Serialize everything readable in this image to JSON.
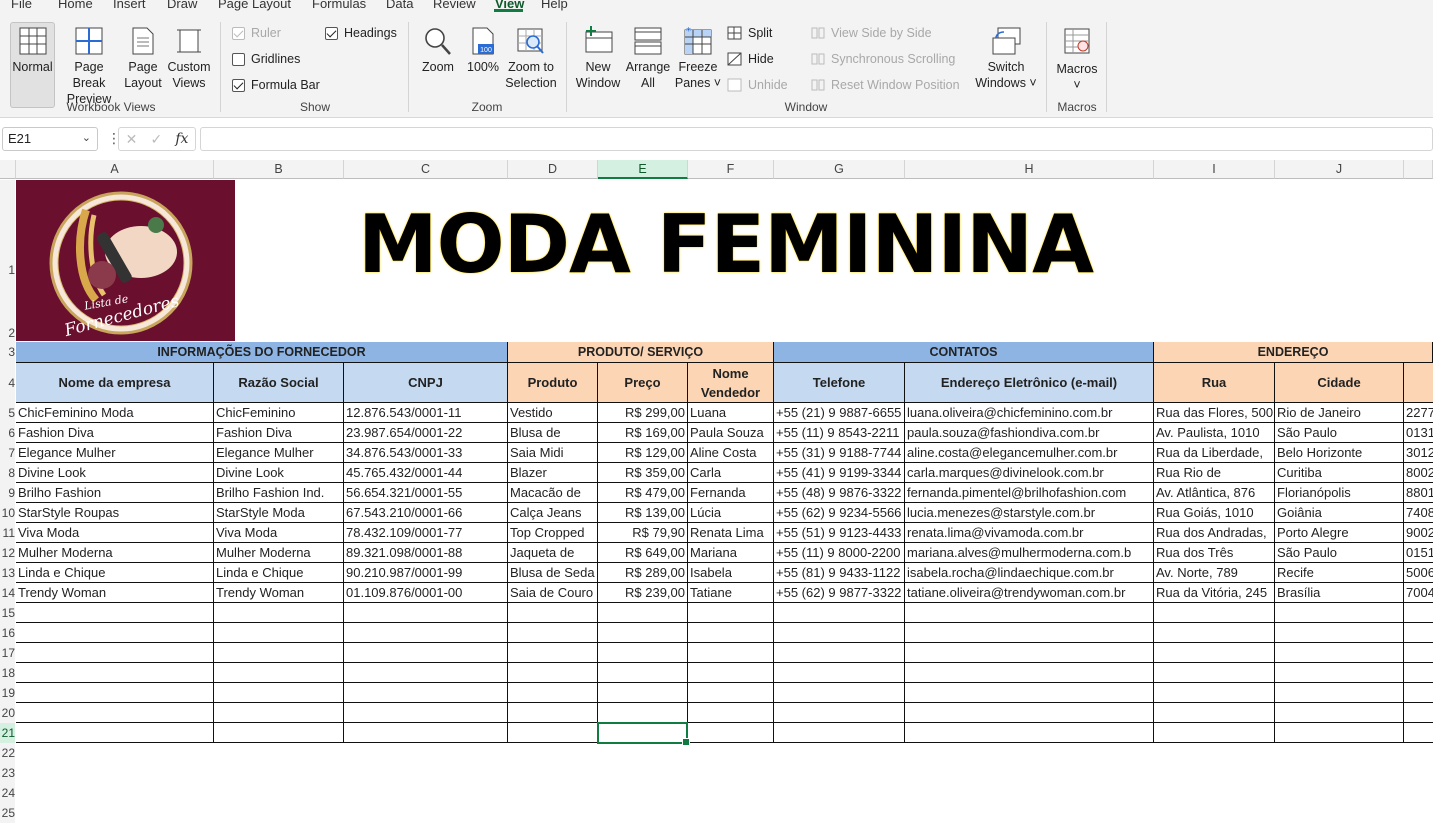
{
  "menu": [
    "File",
    "Home",
    "Insert",
    "Draw",
    "Page Layout",
    "Formulas",
    "Data",
    "Review",
    "View",
    "Help"
  ],
  "menu_active": "View",
  "ribbon": {
    "workbook_views": {
      "label": "Workbook Views",
      "normal": "Normal",
      "page_break": "Page Break",
      "page_break2": "Preview",
      "page_layout": "Page",
      "page_layout2": "Layout",
      "custom": "Custom",
      "custom2": "Views"
    },
    "show": {
      "label": "Show",
      "ruler": "Ruler",
      "gridlines": "Gridlines",
      "formula_bar": "Formula Bar",
      "headings": "Headings",
      "ruler_checked": true,
      "gridlines_checked": false,
      "formula_bar_checked": true,
      "headings_checked": true
    },
    "zoom": {
      "label": "Zoom",
      "zoom": "Zoom",
      "hundred": "100%",
      "zoom_sel": "Zoom to",
      "zoom_sel2": "Selection",
      "badge": "100"
    },
    "window": {
      "label": "Window",
      "new_window": "New",
      "new_window2": "Window",
      "arrange": "Arrange",
      "arrange2": "All",
      "freeze": "Freeze",
      "freeze2": "Panes ˅",
      "split": "Split",
      "hide": "Hide",
      "unhide": "Unhide",
      "side_by_side": "View Side by Side",
      "sync_scroll": "Synchronous Scrolling",
      "reset_pos": "Reset Window Position",
      "switch": "Switch",
      "switch2": "Windows ˅"
    },
    "macros": {
      "label": "Macros",
      "macros": "Macros",
      "macros2": "˅"
    }
  },
  "formula_bar": {
    "name_box": "E21",
    "fx": "fx",
    "content": ""
  },
  "columns": [
    "A",
    "B",
    "C",
    "D",
    "E",
    "F",
    "G",
    "H",
    "I",
    "J",
    ""
  ],
  "selected_column": "E",
  "rows": [
    "1",
    "2",
    "3",
    "4",
    "5",
    "6",
    "7",
    "8",
    "9",
    "10",
    "11",
    "12",
    "13",
    "14",
    "15",
    "16",
    "17",
    "18",
    "19",
    "20",
    "21",
    "22",
    "23",
    "24",
    "25"
  ],
  "selected_row": "21",
  "title": "MODA FEMININA",
  "logo": {
    "line1": "Lista de",
    "line2": "Fornecedores"
  },
  "group_headers": {
    "fornecedor": "INFORMAÇÕES DO FORNECEDOR",
    "produto": "PRODUTO/ SERVIÇO",
    "contatos": "CONTATOS",
    "endereco": "ENDEREÇO"
  },
  "col_headers": {
    "a": "Nome da empresa",
    "b": "Razão Social",
    "c": "CNPJ",
    "d": "Produto",
    "e": "Preço",
    "f": "Nome Vendedor",
    "g": "Telefone",
    "h": "Endereço Eletrônico (e-mail)",
    "i": "Rua",
    "j": "Cidade"
  },
  "table": [
    [
      "ChicFeminino Moda",
      "ChicFeminino",
      "12.876.543/0001-11",
      "Vestido",
      "R$ 299,00",
      "Luana",
      "+55 (21) 9 9887-6655",
      "luana.oliveira@chicfeminino.com.br",
      "Rua das Flores, 500",
      "Rio de Janeiro",
      "2277"
    ],
    [
      "Fashion Diva",
      "Fashion Diva",
      "23.987.654/0001-22",
      "Blusa de",
      "R$ 169,00",
      "Paula Souza",
      "+55 (11) 9 8543-2211",
      "paula.souza@fashiondiva.com.br",
      "Av. Paulista, 1010",
      "São Paulo",
      "0131"
    ],
    [
      "Elegance Mulher",
      "Elegance Mulher",
      "34.876.543/0001-33",
      "Saia Midi",
      "R$ 129,00",
      "Aline Costa",
      "+55 (31) 9 9188-7744",
      "aline.costa@elegancemulher.com.br",
      "Rua da Liberdade,",
      "Belo Horizonte",
      "3012"
    ],
    [
      "Divine Look",
      "Divine Look",
      "45.765.432/0001-44",
      "Blazer",
      "R$ 359,00",
      "Carla",
      "+55 (41) 9 9199-3344",
      "carla.marques@divinelook.com.br",
      "Rua Rio de",
      "Curitiba",
      "8002"
    ],
    [
      "Brilho Fashion",
      "Brilho Fashion Ind.",
      "56.654.321/0001-55",
      "Macacão de",
      "R$ 479,00",
      "Fernanda",
      "+55 (48) 9 9876-3322",
      "fernanda.pimentel@brilhofashion.com",
      "Av. Atlântica, 876",
      "Florianópolis",
      "8801"
    ],
    [
      "StarStyle Roupas",
      "StarStyle Moda",
      "67.543.210/0001-66",
      "Calça Jeans",
      "R$ 139,00",
      "Lúcia",
      "+55 (62) 9 9234-5566",
      "lucia.menezes@starstyle.com.br",
      "Rua Goiás, 1010",
      "Goiânia",
      "7408"
    ],
    [
      "Viva Moda",
      "Viva Moda",
      "78.432.109/0001-77",
      "Top Cropped",
      "R$ 79,90",
      "Renata Lima",
      "+55 (51) 9 9123-4433",
      "renata.lima@vivamoda.com.br",
      "Rua dos Andradas,",
      "Porto Alegre",
      "9002"
    ],
    [
      "Mulher Moderna",
      "Mulher Moderna",
      "89.321.098/0001-88",
      "Jaqueta de",
      "R$ 649,00",
      "Mariana",
      "+55 (11) 9 8000-2200",
      "mariana.alves@mulhermoderna.com.b",
      "Rua dos Três",
      "São Paulo",
      "0151"
    ],
    [
      "Linda e Chique",
      "Linda e Chique",
      "90.210.987/0001-99",
      "Blusa de Seda",
      "R$ 289,00",
      "Isabela",
      "+55 (81) 9 9433-1122",
      "isabela.rocha@lindaechique.com.br",
      "Av. Norte, 789",
      "Recife",
      "5006"
    ],
    [
      "Trendy Woman",
      "Trendy Woman",
      "01.109.876/0001-00",
      "Saia de Couro",
      "R$ 239,00",
      "Tatiane",
      "+55 (62) 9 9877-3322",
      "tatiane.oliveira@trendywoman.com.br",
      "Rua da Vitória, 245",
      "Brasília",
      "7004"
    ]
  ],
  "colors": {
    "accent": "#107c41",
    "group_blue": "#8db4e2",
    "group_orange": "#fcd5b4",
    "header_blue": "#c5d9f1",
    "logo_bg": "#6a0f2e"
  }
}
